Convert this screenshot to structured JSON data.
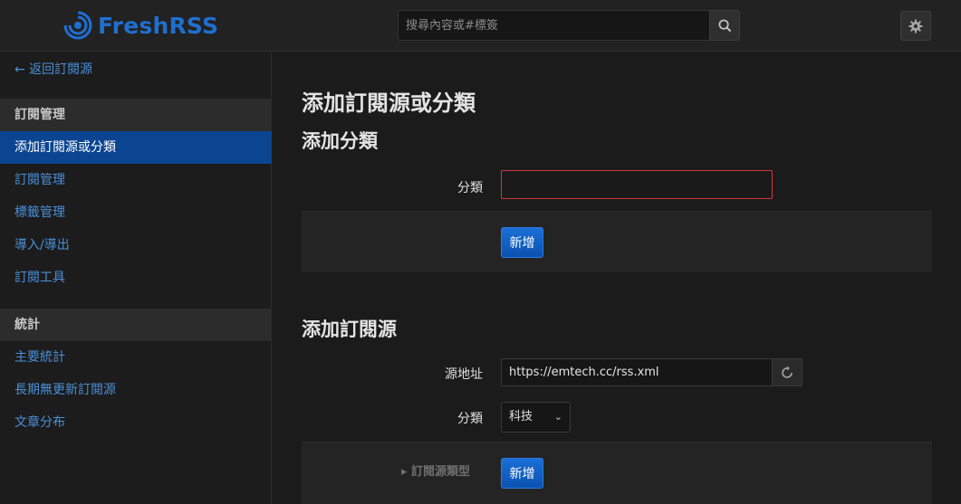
{
  "header": {
    "logo_text": "FreshRSS",
    "search_placeholder": "搜尋內容或#標簽",
    "brand_color": "#1f6fd0"
  },
  "sidebar": {
    "back_link": "← 返回訂閱源",
    "section1": "訂閱管理",
    "items1": [
      "添加訂閱源或分類",
      "訂閱管理",
      "標籤管理",
      "導入/導出",
      "訂閱工具"
    ],
    "section2": "統計",
    "items2": [
      "主要統計",
      "長期無更新訂閱源",
      "文章分布"
    ]
  },
  "main": {
    "page_title": "添加訂閱源或分類",
    "add_category": {
      "title": "添加分類",
      "category_label": "分類",
      "category_value": "",
      "submit": "新增"
    },
    "add_feed": {
      "title": "添加訂閱源",
      "url_label": "源地址",
      "url_value": "https://emtech.cc/rss.xml",
      "category_label": "分類",
      "category_selected": "科技",
      "type_toggle": "▸ 訂閱源類型",
      "submit": "新增"
    }
  }
}
